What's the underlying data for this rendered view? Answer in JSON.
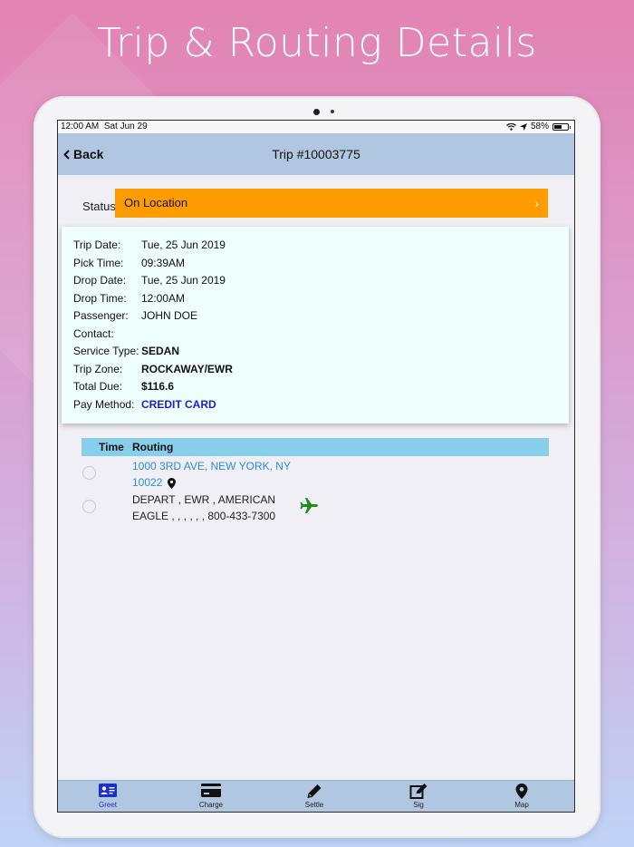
{
  "marketing": {
    "title": "Trip & Routing Details"
  },
  "statusbar": {
    "time": "12:00 AM",
    "date": "Sat Jun 29",
    "battery": "58%"
  },
  "navbar": {
    "back_label": "Back",
    "title": "Trip #10003775"
  },
  "status": {
    "label": "Status",
    "value": "On Location",
    "color": "#fe9c00"
  },
  "trip_info": [
    {
      "label": "Trip Date:",
      "value": "Tue, 25 Jun 2019",
      "style": "normal"
    },
    {
      "label": "Pick Time:",
      "value": "09:39AM",
      "style": "normal"
    },
    {
      "label": "Drop Date:",
      "value": "Tue, 25 Jun 2019",
      "style": "normal"
    },
    {
      "label": "Drop Time:",
      "value": "12:00AM",
      "style": "normal"
    },
    {
      "label": "Passenger:",
      "value": "JOHN DOE",
      "style": "normal"
    },
    {
      "label": "Contact:",
      "value": "",
      "style": "normal"
    },
    {
      "label": "Service Type:",
      "value": "SEDAN",
      "style": "bold"
    },
    {
      "label": "Trip Zone:",
      "value": "ROCKAWAY/EWR",
      "style": "bold"
    },
    {
      "label": "Total Due:",
      "value": "$116.6",
      "style": "bold"
    },
    {
      "label": "Pay Method:",
      "value": "CREDIT CARD",
      "style": "blue"
    }
  ],
  "routing": {
    "header_time": "Time",
    "header_routing": "Routing",
    "stops": [
      {
        "line1": "1000 3RD AVE, NEW YORK, NY",
        "line2": "10022",
        "icon": "map-pin-icon"
      },
      {
        "line1": "DEPART , EWR , AMERICAN",
        "line2": "EAGLE , , , , , , 800-433-7300",
        "icon": "airplane-icon"
      }
    ]
  },
  "tabs": [
    {
      "label": "Greet",
      "icon": "greet-icon",
      "active": true
    },
    {
      "label": "Charge",
      "icon": "credit-card-icon",
      "active": false
    },
    {
      "label": "Settle",
      "icon": "pencil-icon",
      "active": false
    },
    {
      "label": "Sig",
      "icon": "edit-icon",
      "active": false
    },
    {
      "label": "Map",
      "icon": "map-pin-icon",
      "active": false
    }
  ]
}
